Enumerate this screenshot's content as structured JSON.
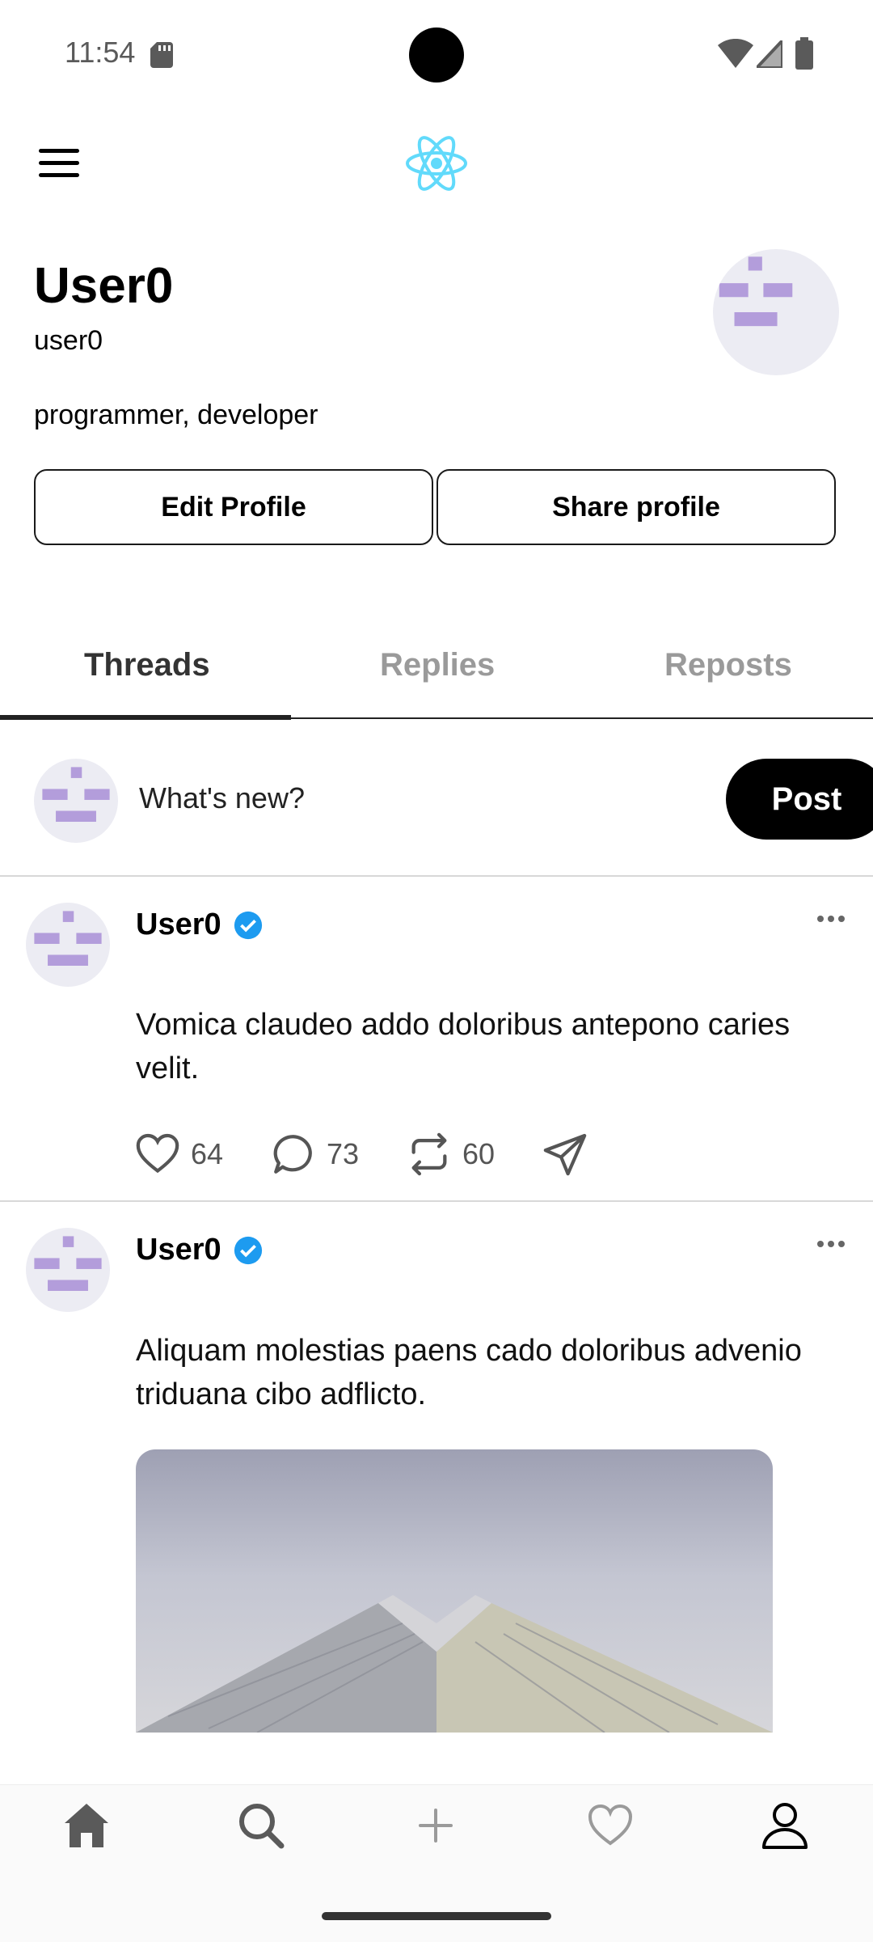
{
  "status_bar": {
    "time": "11:54"
  },
  "profile": {
    "display_name": "User0",
    "username": "user0",
    "bio": "programmer, developer",
    "edit_label": "Edit Profile",
    "share_label": "Share profile"
  },
  "tabs": [
    {
      "label": "Threads",
      "active": true
    },
    {
      "label": "Replies",
      "active": false
    },
    {
      "label": "Reposts",
      "active": false
    }
  ],
  "composer": {
    "placeholder": "What's new?",
    "post_label": "Post"
  },
  "threads": [
    {
      "author": "User0",
      "verified": true,
      "text": "Vomica claudeo addo doloribus antepono caries velit.",
      "likes": "64",
      "replies": "73",
      "reposts": "60"
    },
    {
      "author": "User0",
      "verified": true,
      "text": "Aliquam molestias paens cado doloribus advenio triduana cibo adflicto.",
      "has_image": true
    }
  ],
  "bottom_nav": [
    "home-icon",
    "search-icon",
    "plus-icon",
    "heart-icon",
    "profile-icon"
  ],
  "colors": {
    "accent_verified": "#1d9bf0",
    "avatar_pattern": "#b39ddb",
    "logo": "#61dafb"
  }
}
